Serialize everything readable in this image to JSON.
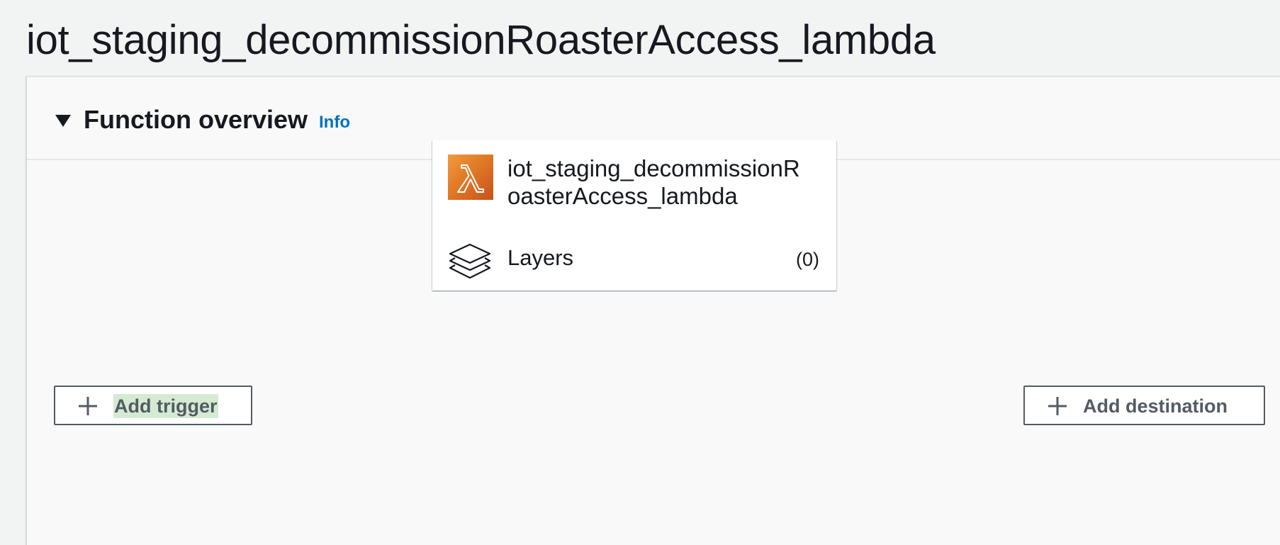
{
  "page": {
    "title": "iot_staging_decommissionRoasterAccess_lambda"
  },
  "overview": {
    "title": "Function overview",
    "info_link": "Info",
    "caret_icon": "caret-down-icon",
    "expanded": true
  },
  "function_card": {
    "icon": "lambda-icon",
    "name": "iot_staging_decommissionRoasterAccess_lambda",
    "layers_icon": "layers-icon",
    "layers_label": "Layers",
    "layers_count": "(0)"
  },
  "actions": {
    "add_trigger_label": "Add trigger",
    "add_destination_label": "Add destination",
    "plus_icon": "plus-icon"
  },
  "colors": {
    "page_background": "#f2f3f3",
    "panel_background": "#f9f9f9",
    "link": "#0073bb",
    "lambda_orange": "#e07a27",
    "button_border": "#545b64",
    "text_highlight": "#d5ead2"
  }
}
